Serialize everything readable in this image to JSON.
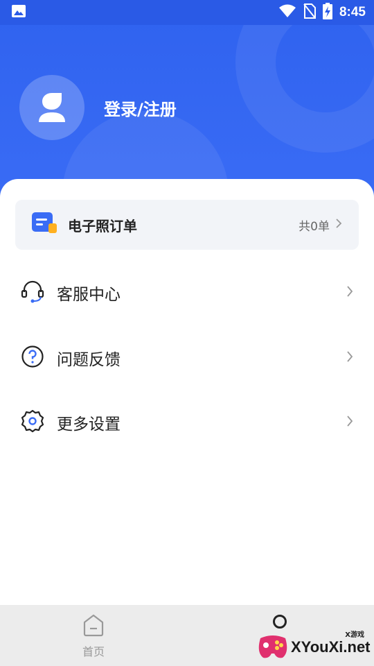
{
  "status_bar": {
    "time": "8:45"
  },
  "profile": {
    "login_label": "登录/注册"
  },
  "order_card": {
    "title": "电子照订单",
    "count": "共0单"
  },
  "menu": [
    {
      "label": "客服中心",
      "icon": "headset-icon"
    },
    {
      "label": "问题反馈",
      "icon": "question-icon"
    },
    {
      "label": "更多设置",
      "icon": "gear-icon"
    }
  ],
  "bottom_nav": {
    "home_label": "首页"
  },
  "watermark": {
    "small": "X游戏",
    "main": "XYouXi",
    "tld": ".net"
  },
  "colors": {
    "primary": "#2f62ef",
    "card_bg": "#f2f4f8",
    "nav_bg": "#ececec"
  }
}
